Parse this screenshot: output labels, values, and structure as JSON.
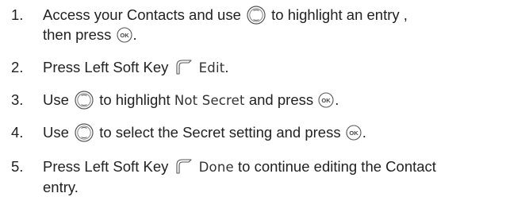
{
  "steps": [
    {
      "number": "1.",
      "line1_a": "Access your Contacts and use",
      "line1_b": "to highlight an entry ,",
      "line2_a": "then press",
      "line2_b": "."
    },
    {
      "number": "2.",
      "text_a": "Press Left Soft Key",
      "ui_label": "Edit",
      "text_b": "."
    },
    {
      "number": "3.",
      "text_a": "Use",
      "text_b": "to highlight",
      "ui_label": "Not Secret",
      "text_c": "and press",
      "text_d": "."
    },
    {
      "number": "4.",
      "text_a": "Use",
      "text_b": "to select the Secret setting and press",
      "text_c": "."
    },
    {
      "number": "5.",
      "line1_a": "Press Left Soft Key",
      "ui_label": "Done",
      "line1_b": "to continue editing the Contact",
      "line2": "entry."
    }
  ],
  "icons": {
    "nav_key": "navigation-key-icon",
    "ok_key": "ok-key-icon",
    "ok_label": "OK",
    "left_soft_key": "left-soft-key-icon"
  }
}
